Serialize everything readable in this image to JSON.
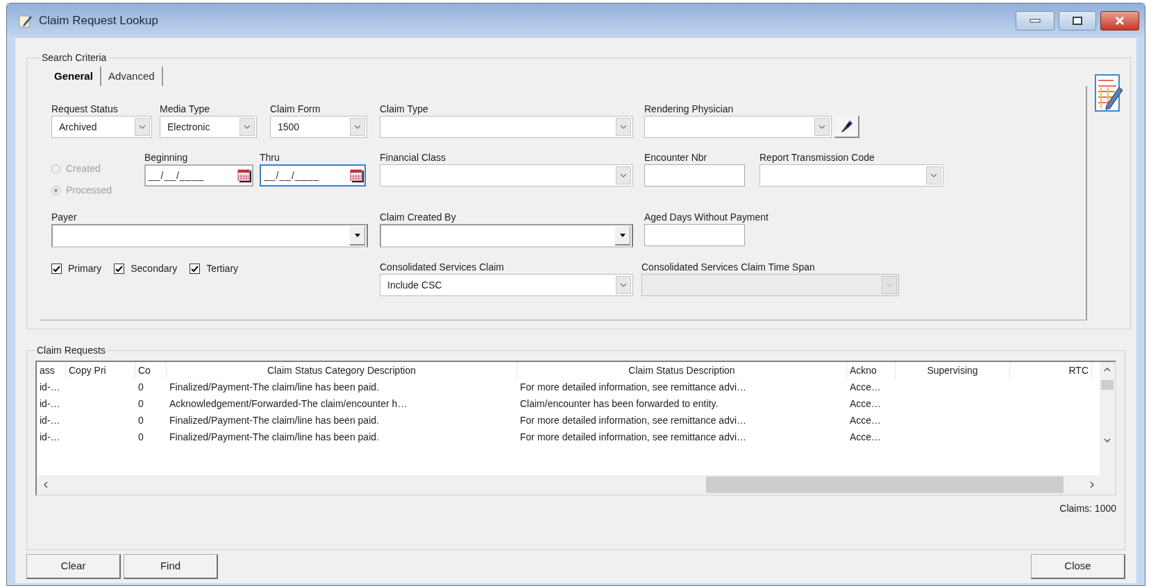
{
  "window": {
    "title": "Claim Request Lookup"
  },
  "search_criteria": {
    "title": "Search Criteria",
    "tabs": [
      {
        "label": "General",
        "selected": true
      },
      {
        "label": "Advanced",
        "selected": false
      }
    ],
    "rows": [
      [
        {
          "kind": "dropdown",
          "label": "Request Status",
          "value": "Archived"
        },
        {
          "kind": "dropdown",
          "label": "Media Type",
          "value": "Electronic"
        },
        {
          "kind": "dropdown",
          "label": "Claim Form",
          "value": "1500"
        },
        {
          "kind": "dropdown",
          "label": "Claim Type"
        },
        {
          "kind": "dropdown",
          "label": "Rendering Physician",
          "lookup": true
        }
      ],
      [
        {
          "kind": "radio",
          "options": [
            {
              "label": "Created",
              "selected": false,
              "disabled": true
            },
            {
              "label": "Processed",
              "selected": true,
              "disabled": true
            }
          ]
        },
        {
          "kind": "date",
          "label": "Beginning",
          "value": "__/__/____",
          "focused": false
        },
        {
          "kind": "date",
          "label": "Thru",
          "value": "__/__/____",
          "focused": true
        },
        {
          "kind": "dropdown",
          "label": "Financial Class"
        },
        {
          "kind": "text",
          "label": "Encounter Nbr"
        },
        {
          "kind": "dropdown",
          "label": "Report Transmission Code"
        }
      ],
      [
        {
          "kind": "combo",
          "label": "Payer"
        },
        {
          "kind": "combo",
          "label": "Claim Created By"
        },
        {
          "kind": "text",
          "label": "Aged Days Without Payment"
        }
      ],
      [
        {
          "kind": "checks",
          "options": [
            {
              "label": "Primary",
              "checked": true
            },
            {
              "label": "Secondary",
              "checked": true
            },
            {
              "label": "Tertiary",
              "checked": true
            }
          ]
        },
        {
          "kind": "dropdown",
          "label": "Consolidated Services Claim",
          "value": "Include CSC"
        },
        {
          "kind": "dropdown",
          "label": "Consolidated Services Claim Time Span",
          "disabled": true
        }
      ]
    ]
  },
  "claim_requests": {
    "title": "Claim Requests",
    "columns": [
      "ass",
      "Copy Pri",
      "Co",
      "Claim Status Category Description",
      "Claim Status Description",
      "Ackno",
      "Supervising",
      "RTC"
    ],
    "rows": [
      [
        "id-…",
        null,
        "0",
        "Finalized/Payment-The claim/line has been paid.",
        "For more detailed information, see remittance advi…",
        "Acce…",
        null,
        null
      ],
      [
        "id-…",
        null,
        "0",
        "Acknowledgement/Forwarded-The claim/encounter h…",
        "Claim/encounter has been forwarded to entity.",
        "Acce…",
        null,
        null
      ],
      [
        "id-…",
        null,
        "0",
        "Finalized/Payment-The claim/line has been paid.",
        "For more detailed information, see remittance advi…",
        "Acce…",
        null,
        null
      ],
      [
        "id-…",
        null,
        "0",
        "Finalized/Payment-The claim/line has been paid.",
        "For more detailed information, see remittance advi…",
        "Acce…",
        null,
        null
      ]
    ],
    "count": "Claims: 1000"
  },
  "buttons": [
    {
      "label": "Clear"
    },
    {
      "label": "Find"
    }
  ],
  "close_button": {
    "label": "Close"
  }
}
